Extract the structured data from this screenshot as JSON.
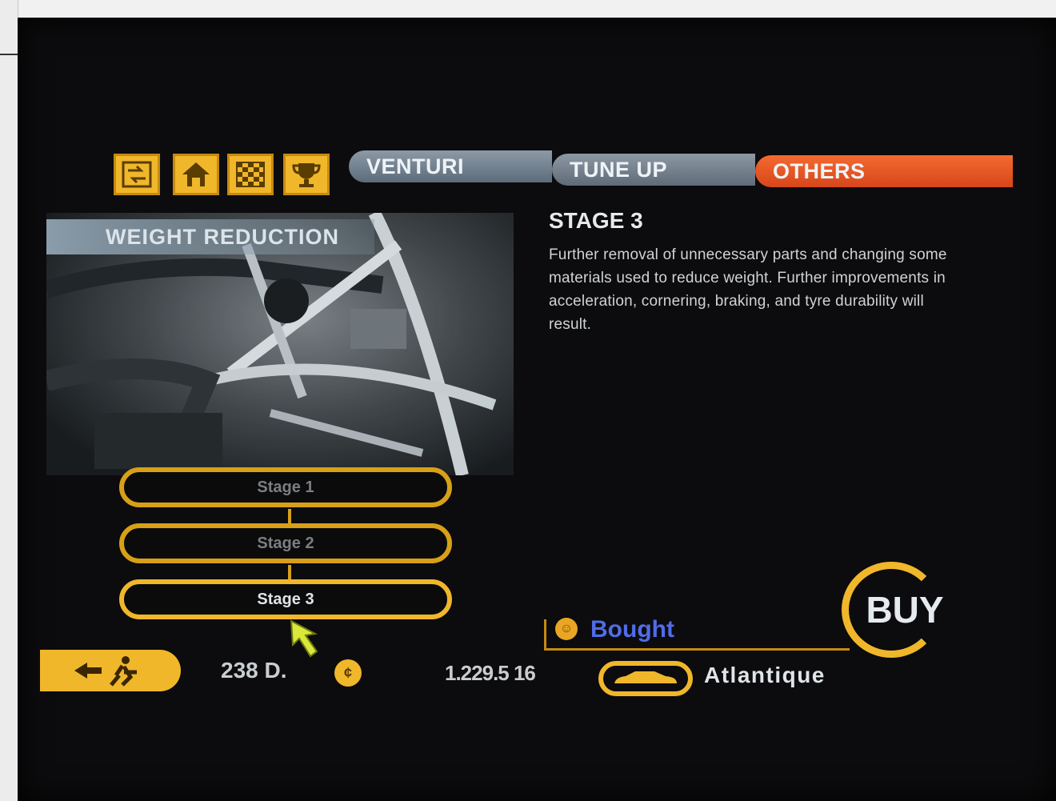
{
  "toolbar": {
    "icons": [
      "swap-icon",
      "garage-icon",
      "checkered-flag-icon",
      "trophy-icon"
    ]
  },
  "tabs": [
    {
      "label": "VENTURI",
      "active": false
    },
    {
      "label": "TUNE UP",
      "active": false
    },
    {
      "label": "OTHERS",
      "active": true
    }
  ],
  "preview": {
    "title": "WEIGHT REDUCTION"
  },
  "description": {
    "title": "STAGE 3",
    "body": "Further removal of unnecessary parts and changing some materials used to reduce weight. Further improvements in acceleration, cornering, braking, and tyre durability will result."
  },
  "stages": [
    {
      "label": "Stage 1",
      "selected": false
    },
    {
      "label": "Stage 2",
      "selected": false
    },
    {
      "label": "Stage 3",
      "selected": true
    }
  ],
  "status": {
    "bought": "Bought"
  },
  "buy": {
    "label": "BUY"
  },
  "footer": {
    "credits": "238 D.",
    "odometer": "1.229.5 16",
    "car": "Atlantique"
  },
  "colors": {
    "accent": "#f0b72b",
    "tab_active": "#e25a22",
    "tab_inactive": "#7a8896",
    "bought_text": "#4f6de8",
    "background": "#0c0b0d"
  }
}
